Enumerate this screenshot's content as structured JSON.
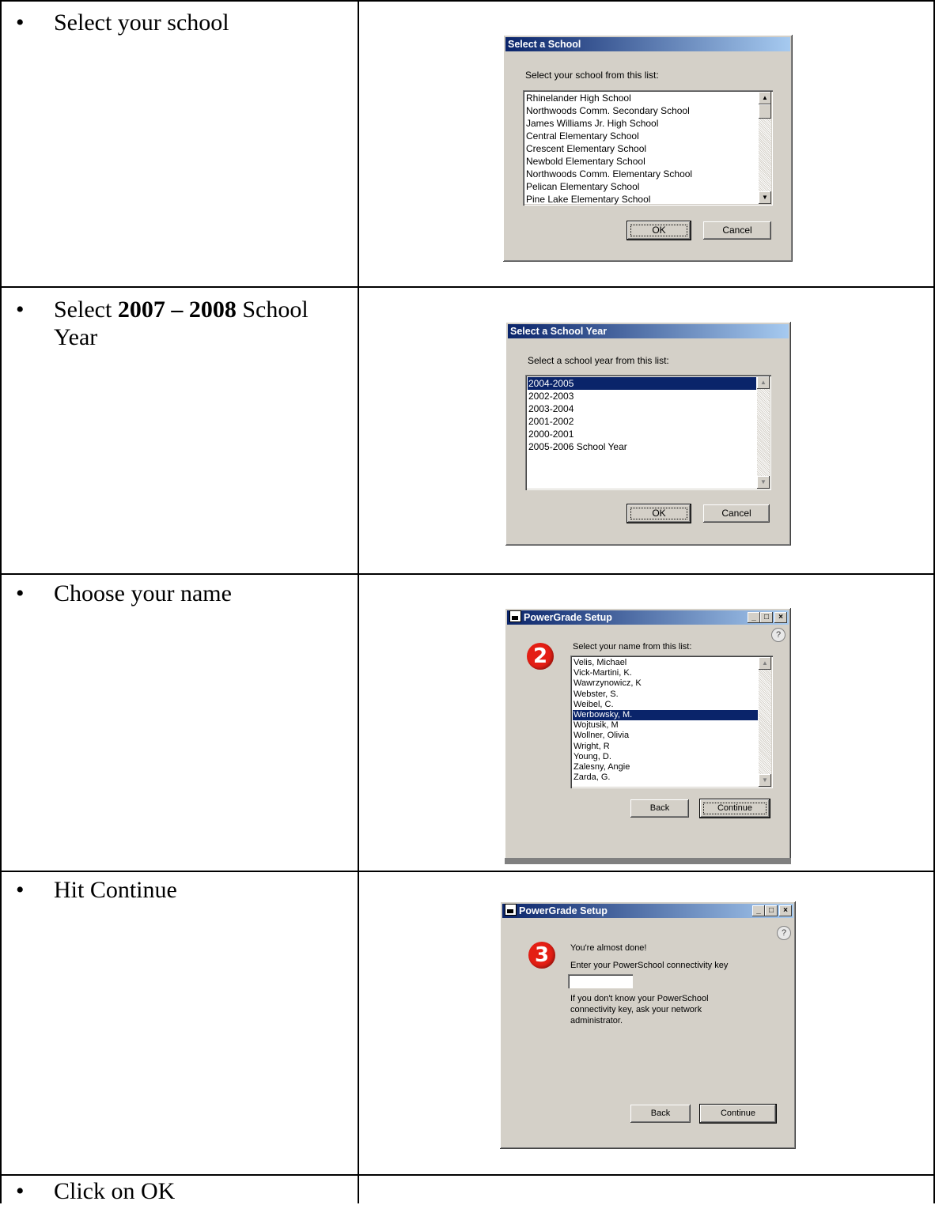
{
  "steps": [
    {
      "bullet": "•",
      "text": "Select your school"
    },
    {
      "bullet": "•",
      "text_pre": "Select ",
      "text_bold": "2007 – 2008",
      "text_post": " School Year"
    },
    {
      "bullet": "•",
      "text": "Choose your name"
    },
    {
      "bullet": "•",
      "text": "Hit Continue"
    },
    {
      "bullet": "•",
      "text": "Click on OK"
    }
  ],
  "dialog_school": {
    "title": "Select a School",
    "prompt": "Select your school from this list:",
    "items": [
      "Rhinelander High School",
      "Northwoods Comm. Secondary School",
      "James Williams Jr. High School",
      "Central Elementary School",
      "Crescent Elementary School",
      "Newbold Elementary School",
      "Northwoods Comm. Elementary School",
      "Pelican Elementary School",
      "Pine Lake Elementary School"
    ],
    "ok_label": "OK",
    "cancel_label": "Cancel"
  },
  "dialog_year": {
    "title": "Select a School Year",
    "prompt": "Select a school year from this list:",
    "items": [
      "2004-2005",
      "2002-2003",
      "2003-2004",
      "2001-2002",
      "2000-2001",
      "2005-2006 School Year"
    ],
    "selected_index": 0,
    "ok_label": "OK",
    "cancel_label": "Cancel"
  },
  "dialog_name": {
    "title": "PowerGrade Setup",
    "step_number": "2",
    "prompt": "Select your name from this list:",
    "items": [
      "Velis, Michael",
      "Vick-Martini, K.",
      "Wawrzynowicz, K",
      "Webster, S.",
      "Weibel, C.",
      "Werbowsky, M.",
      "Wojtusik, M",
      "Wollner, Olivia",
      "Wright, R",
      "Young, D.",
      "Zalesny, Angie",
      "Zarda, G."
    ],
    "selected_index": 5,
    "back_label": "Back",
    "continue_label": "Continue",
    "help": "?",
    "min": "_",
    "max": "□",
    "close": "×"
  },
  "dialog_key": {
    "title": "PowerGrade Setup",
    "step_number": "3",
    "line1": "You're almost done!",
    "line2": "Enter your PowerSchool connectivity key",
    "key_value": "",
    "info_line1": "If you don't know your PowerSchool",
    "info_line2": "connectivity key, ask your network",
    "info_line3": "administrator.",
    "back_label": "Back",
    "continue_label": "Continue",
    "help": "?",
    "min": "_",
    "max": "□",
    "close": "×"
  },
  "colors": {
    "dialog_face": "#d4d0c8",
    "title_active": "#0a246a",
    "selection": "#0a246a",
    "badge": "#e41e14"
  }
}
